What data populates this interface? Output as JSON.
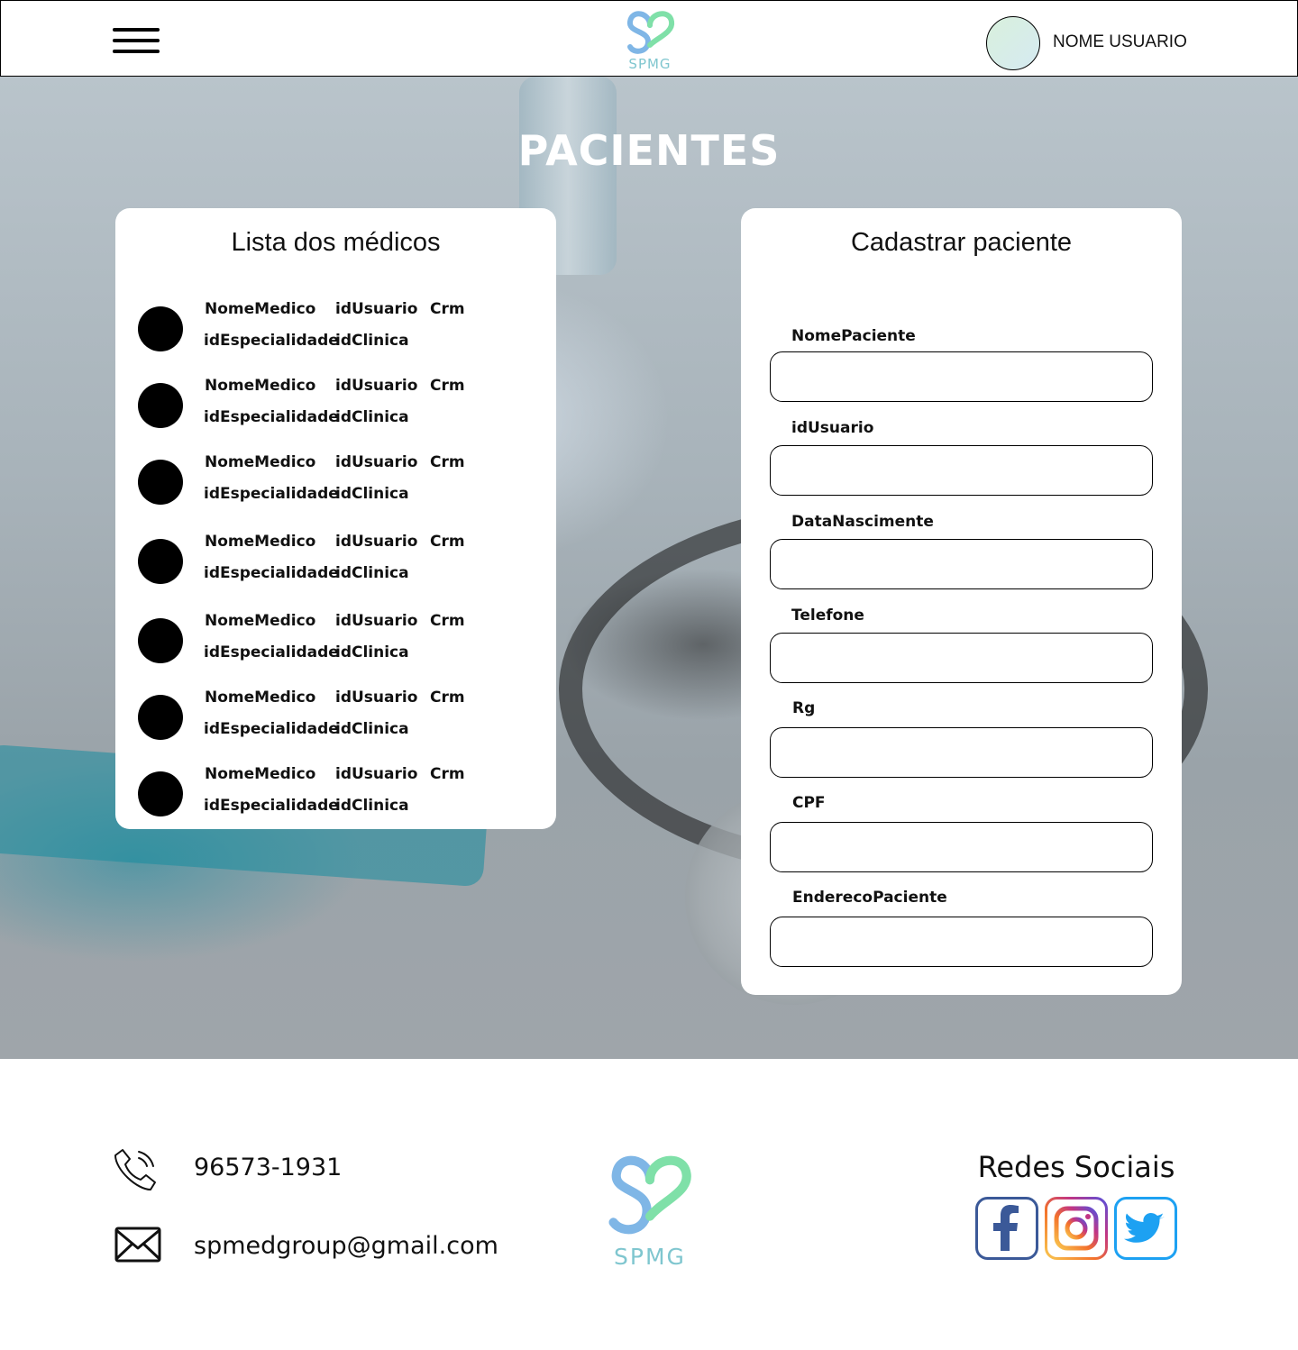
{
  "header": {
    "logo_text": "SPMG",
    "user_name": "NOME USUARIO"
  },
  "page": {
    "title": "PACIENTES"
  },
  "doctors_card": {
    "title": "Lista dos médicos",
    "items": [
      {
        "nome": "NomeMedico",
        "id_usuario": "idUsuario",
        "crm": "Crm",
        "id_especialidade": "idEspecialidade",
        "id_clinica": "idClinica"
      },
      {
        "nome": "NomeMedico",
        "id_usuario": "idUsuario",
        "crm": "Crm",
        "id_especialidade": "idEspecialidade",
        "id_clinica": "idClinica"
      },
      {
        "nome": "NomeMedico",
        "id_usuario": "idUsuario",
        "crm": "Crm",
        "id_especialidade": "idEspecialidade",
        "id_clinica": "idClinica"
      },
      {
        "nome": "NomeMedico",
        "id_usuario": "idUsuario",
        "crm": "Crm",
        "id_especialidade": "idEspecialidade",
        "id_clinica": "idClinica"
      },
      {
        "nome": "NomeMedico",
        "id_usuario": "idUsuario",
        "crm": "Crm",
        "id_especialidade": "idEspecialidade",
        "id_clinica": "idClinica"
      },
      {
        "nome": "NomeMedico",
        "id_usuario": "idUsuario",
        "crm": "Crm",
        "id_especialidade": "idEspecialidade",
        "id_clinica": "idClinica"
      },
      {
        "nome": "NomeMedico",
        "id_usuario": "idUsuario",
        "crm": "Crm",
        "id_especialidade": "idEspecialidade",
        "id_clinica": "idClinica"
      }
    ]
  },
  "form_card": {
    "title": "Cadastrar paciente",
    "fields": [
      {
        "label": "NomePaciente",
        "value": ""
      },
      {
        "label": "idUsuario",
        "value": ""
      },
      {
        "label": "DataNascimente",
        "value": ""
      },
      {
        "label": "Telefone",
        "value": ""
      },
      {
        "label": "Rg",
        "value": ""
      },
      {
        "label": "CPF",
        "value": ""
      },
      {
        "label": "EnderecoPaciente",
        "value": ""
      }
    ]
  },
  "footer": {
    "phone": "96573-1931",
    "email": "spmedgroup@gmail.com",
    "logo_text": "SPMG",
    "social_title": "Redes Sociais",
    "social": [
      {
        "name": "facebook-icon",
        "color": "#3b5998"
      },
      {
        "name": "instagram-icon",
        "color": "#c13584"
      },
      {
        "name": "twitter-icon",
        "color": "#1da1f2"
      }
    ]
  },
  "colors": {
    "logo_blue": "#7fb6e6",
    "logo_green": "#7fe0a8",
    "logo_text": "#7fc6cf"
  }
}
